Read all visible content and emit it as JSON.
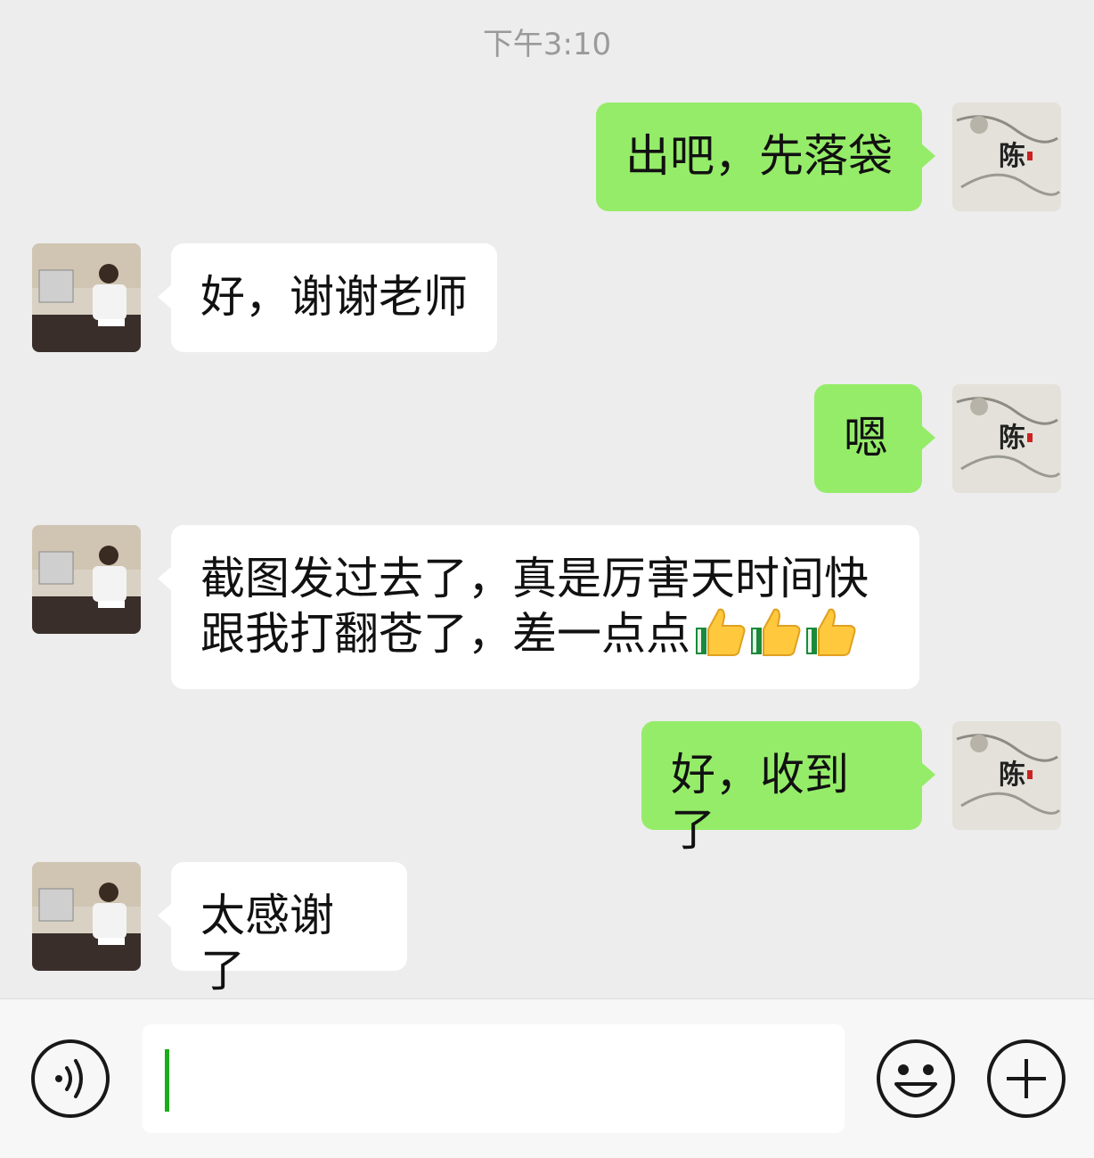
{
  "timestamp": "下午3:10",
  "messages": [
    {
      "side": "out",
      "text": "出吧，先落袋"
    },
    {
      "side": "in",
      "text": "好，谢谢老师"
    },
    {
      "side": "out",
      "text": "嗯"
    },
    {
      "side": "in",
      "text": "截图发过去了，真是厉害天时间快\n跟我打翻苍了，差一点点",
      "emoji": [
        "thumbs-up-icon",
        "thumbs-up-icon",
        "thumbs-up-icon"
      ]
    },
    {
      "side": "out",
      "text": "好，收到了"
    },
    {
      "side": "in",
      "text": "太感谢了"
    }
  ],
  "avatars": {
    "self_text": "陈",
    "other": "person-at-desk-photo"
  },
  "input": {
    "value": "",
    "placeholder": ""
  },
  "toolbar": {
    "voice": "voice-icon",
    "emoji": "emoji-icon",
    "more": "plus-icon"
  },
  "colors": {
    "background": "#ededed",
    "outgoing_bubble": "#95ec69",
    "incoming_bubble": "#ffffff",
    "caret": "#1aad19"
  }
}
